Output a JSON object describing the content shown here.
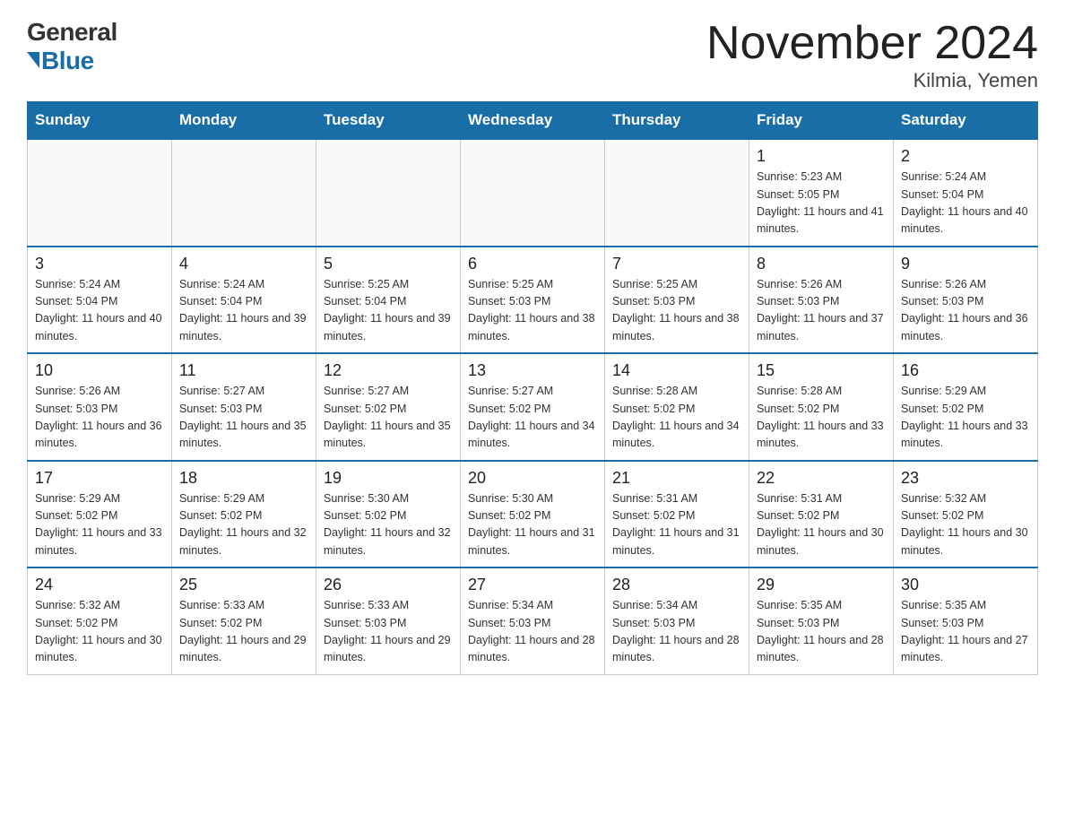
{
  "logo": {
    "general": "General",
    "blue": "Blue"
  },
  "title": "November 2024",
  "location": "Kilmia, Yemen",
  "days_of_week": [
    "Sunday",
    "Monday",
    "Tuesday",
    "Wednesday",
    "Thursday",
    "Friday",
    "Saturday"
  ],
  "weeks": [
    [
      {
        "day": "",
        "info": ""
      },
      {
        "day": "",
        "info": ""
      },
      {
        "day": "",
        "info": ""
      },
      {
        "day": "",
        "info": ""
      },
      {
        "day": "",
        "info": ""
      },
      {
        "day": "1",
        "info": "Sunrise: 5:23 AM\nSunset: 5:05 PM\nDaylight: 11 hours and 41 minutes."
      },
      {
        "day": "2",
        "info": "Sunrise: 5:24 AM\nSunset: 5:04 PM\nDaylight: 11 hours and 40 minutes."
      }
    ],
    [
      {
        "day": "3",
        "info": "Sunrise: 5:24 AM\nSunset: 5:04 PM\nDaylight: 11 hours and 40 minutes."
      },
      {
        "day": "4",
        "info": "Sunrise: 5:24 AM\nSunset: 5:04 PM\nDaylight: 11 hours and 39 minutes."
      },
      {
        "day": "5",
        "info": "Sunrise: 5:25 AM\nSunset: 5:04 PM\nDaylight: 11 hours and 39 minutes."
      },
      {
        "day": "6",
        "info": "Sunrise: 5:25 AM\nSunset: 5:03 PM\nDaylight: 11 hours and 38 minutes."
      },
      {
        "day": "7",
        "info": "Sunrise: 5:25 AM\nSunset: 5:03 PM\nDaylight: 11 hours and 38 minutes."
      },
      {
        "day": "8",
        "info": "Sunrise: 5:26 AM\nSunset: 5:03 PM\nDaylight: 11 hours and 37 minutes."
      },
      {
        "day": "9",
        "info": "Sunrise: 5:26 AM\nSunset: 5:03 PM\nDaylight: 11 hours and 36 minutes."
      }
    ],
    [
      {
        "day": "10",
        "info": "Sunrise: 5:26 AM\nSunset: 5:03 PM\nDaylight: 11 hours and 36 minutes."
      },
      {
        "day": "11",
        "info": "Sunrise: 5:27 AM\nSunset: 5:03 PM\nDaylight: 11 hours and 35 minutes."
      },
      {
        "day": "12",
        "info": "Sunrise: 5:27 AM\nSunset: 5:02 PM\nDaylight: 11 hours and 35 minutes."
      },
      {
        "day": "13",
        "info": "Sunrise: 5:27 AM\nSunset: 5:02 PM\nDaylight: 11 hours and 34 minutes."
      },
      {
        "day": "14",
        "info": "Sunrise: 5:28 AM\nSunset: 5:02 PM\nDaylight: 11 hours and 34 minutes."
      },
      {
        "day": "15",
        "info": "Sunrise: 5:28 AM\nSunset: 5:02 PM\nDaylight: 11 hours and 33 minutes."
      },
      {
        "day": "16",
        "info": "Sunrise: 5:29 AM\nSunset: 5:02 PM\nDaylight: 11 hours and 33 minutes."
      }
    ],
    [
      {
        "day": "17",
        "info": "Sunrise: 5:29 AM\nSunset: 5:02 PM\nDaylight: 11 hours and 33 minutes."
      },
      {
        "day": "18",
        "info": "Sunrise: 5:29 AM\nSunset: 5:02 PM\nDaylight: 11 hours and 32 minutes."
      },
      {
        "day": "19",
        "info": "Sunrise: 5:30 AM\nSunset: 5:02 PM\nDaylight: 11 hours and 32 minutes."
      },
      {
        "day": "20",
        "info": "Sunrise: 5:30 AM\nSunset: 5:02 PM\nDaylight: 11 hours and 31 minutes."
      },
      {
        "day": "21",
        "info": "Sunrise: 5:31 AM\nSunset: 5:02 PM\nDaylight: 11 hours and 31 minutes."
      },
      {
        "day": "22",
        "info": "Sunrise: 5:31 AM\nSunset: 5:02 PM\nDaylight: 11 hours and 30 minutes."
      },
      {
        "day": "23",
        "info": "Sunrise: 5:32 AM\nSunset: 5:02 PM\nDaylight: 11 hours and 30 minutes."
      }
    ],
    [
      {
        "day": "24",
        "info": "Sunrise: 5:32 AM\nSunset: 5:02 PM\nDaylight: 11 hours and 30 minutes."
      },
      {
        "day": "25",
        "info": "Sunrise: 5:33 AM\nSunset: 5:02 PM\nDaylight: 11 hours and 29 minutes."
      },
      {
        "day": "26",
        "info": "Sunrise: 5:33 AM\nSunset: 5:03 PM\nDaylight: 11 hours and 29 minutes."
      },
      {
        "day": "27",
        "info": "Sunrise: 5:34 AM\nSunset: 5:03 PM\nDaylight: 11 hours and 28 minutes."
      },
      {
        "day": "28",
        "info": "Sunrise: 5:34 AM\nSunset: 5:03 PM\nDaylight: 11 hours and 28 minutes."
      },
      {
        "day": "29",
        "info": "Sunrise: 5:35 AM\nSunset: 5:03 PM\nDaylight: 11 hours and 28 minutes."
      },
      {
        "day": "30",
        "info": "Sunrise: 5:35 AM\nSunset: 5:03 PM\nDaylight: 11 hours and 27 minutes."
      }
    ]
  ]
}
